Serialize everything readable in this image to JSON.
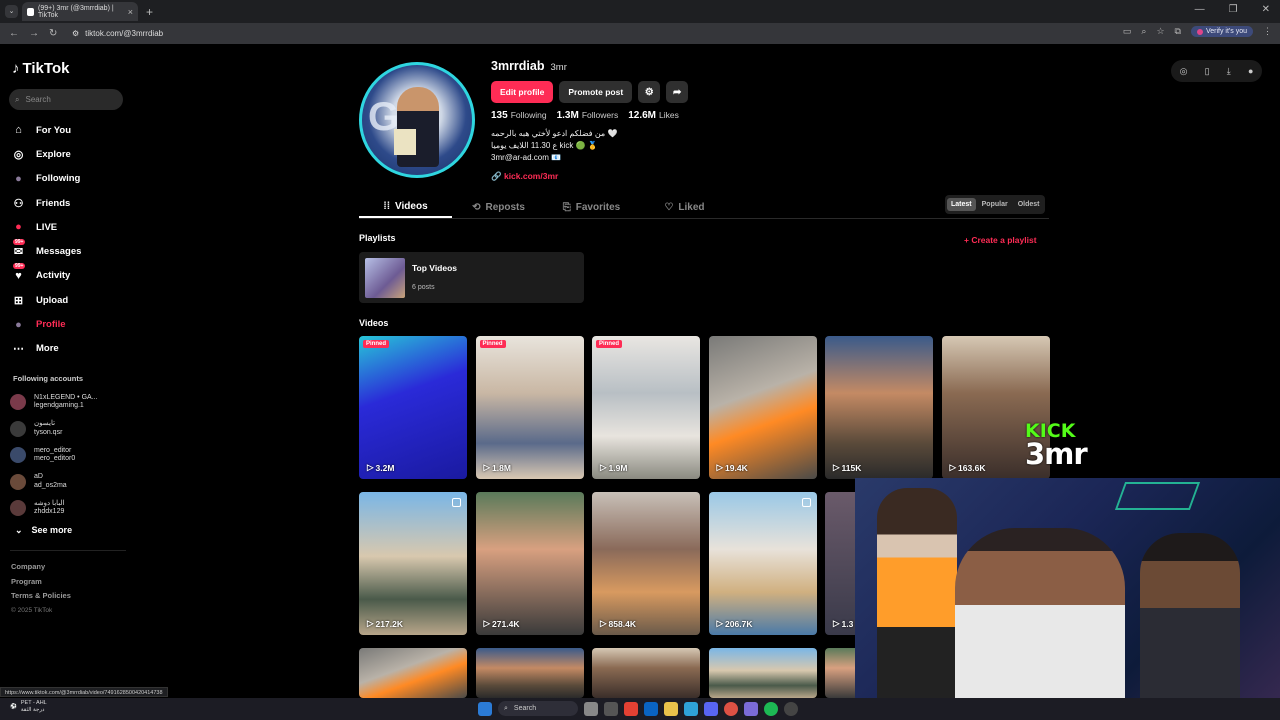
{
  "browser": {
    "tab_title": "(99+) 3mr (@3mrrdiab) | TikTok",
    "url": "tiktok.com/@3mrrdiab",
    "verify_label": "Verify it's you",
    "status_url": "https://www.tiktok.com/@3mrrdiab/video/7491628500420414738"
  },
  "sidebar": {
    "logo": "TikTok",
    "search_placeholder": "Search",
    "menu": [
      {
        "label": "For You",
        "icon": "home-icon"
      },
      {
        "label": "Explore",
        "icon": "compass-icon"
      },
      {
        "label": "Following",
        "icon": "following-avatar-icon"
      },
      {
        "label": "Friends",
        "icon": "friends-icon"
      },
      {
        "label": "LIVE",
        "icon": "live-icon"
      },
      {
        "label": "Messages",
        "icon": "messages-icon",
        "badge": "99+"
      },
      {
        "label": "Activity",
        "icon": "activity-icon",
        "badge": "99+"
      },
      {
        "label": "Upload",
        "icon": "upload-icon"
      },
      {
        "label": "Profile",
        "icon": "profile-avatar-icon"
      },
      {
        "label": "More",
        "icon": "more-icon"
      }
    ],
    "following_title": "Following accounts",
    "following": [
      {
        "name": "N1xLEGEND • GA...",
        "handle": "legendgaming.1"
      },
      {
        "name": "تايسون",
        "handle": "tyson.qsr"
      },
      {
        "name": "mero_editor",
        "handle": "mero_editor0"
      },
      {
        "name": "aD",
        "handle": "ad_os2ma"
      },
      {
        "name": "البابا دوشه",
        "handle": "zhddx129"
      }
    ],
    "see_more": "See more",
    "footer": [
      "Company",
      "Program",
      "Terms & Policies"
    ],
    "copyright": "© 2025 TikTok"
  },
  "profile": {
    "username": "3mrrdiab",
    "nickname": "3mr",
    "edit_btn": "Edit profile",
    "promote_btn": "Promote post",
    "following_count": "135",
    "following_label": "Following",
    "followers_count": "1.3M",
    "followers_label": "Followers",
    "likes_count": "12.6M",
    "likes_label": "Likes",
    "bio_line1": "من فضلكم ادعو لأختي هبه بالرحمه 🤍",
    "bio_line2": "ع 11.30 اللايف يوميا kick 🟢 🥇",
    "bio_line3": "3mr@ar-ad.com 📧",
    "link": "kick.com/3mr"
  },
  "tabs": [
    "Videos",
    "Reposts",
    "Favorites",
    "Liked"
  ],
  "sort": [
    "Latest",
    "Popular",
    "Oldest"
  ],
  "playlists_title": "Playlists",
  "create_playlist": "+ Create a playlist",
  "playlist": {
    "title": "Top Videos",
    "posts": "6 posts"
  },
  "videos_title": "Videos",
  "videos": [
    {
      "views": "3.2M",
      "pinned": "Pinned"
    },
    {
      "views": "1.8M",
      "pinned": "Pinned"
    },
    {
      "views": "1.9M",
      "pinned": "Pinned"
    },
    {
      "views": "19.4K"
    },
    {
      "views": "115K"
    },
    {
      "views": "163.6K"
    },
    {
      "views": "217.2K"
    },
    {
      "views": "271.4K"
    },
    {
      "views": "858.4K"
    },
    {
      "views": "206.7K"
    },
    {
      "views": "1.3"
    }
  ],
  "overlay": {
    "kick_top": "KICK",
    "kick_bottom": "3mr"
  },
  "taskbar": {
    "weather_title": "PET - AHL",
    "weather_sub": "درجة الثقة",
    "search": "Search"
  }
}
